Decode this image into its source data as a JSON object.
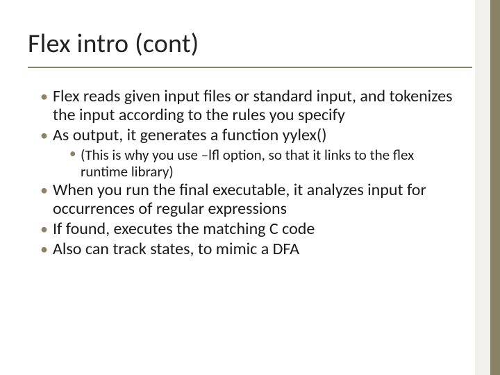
{
  "title": "Flex intro (cont)",
  "bullets": {
    "b1": "Flex reads given input files or standard input, and tokenizes the input according to the rules you specify",
    "b2": "As output, it generates a function yylex()",
    "b2a": "(This is why you use –lfl option, so that it links to the flex runtime library)",
    "b3": "When you run the final executable, it analyzes input for occurrences of regular expressions",
    "b4": "If found, executes the matching C code",
    "b5": "Also can track states, to mimic a DFA"
  }
}
